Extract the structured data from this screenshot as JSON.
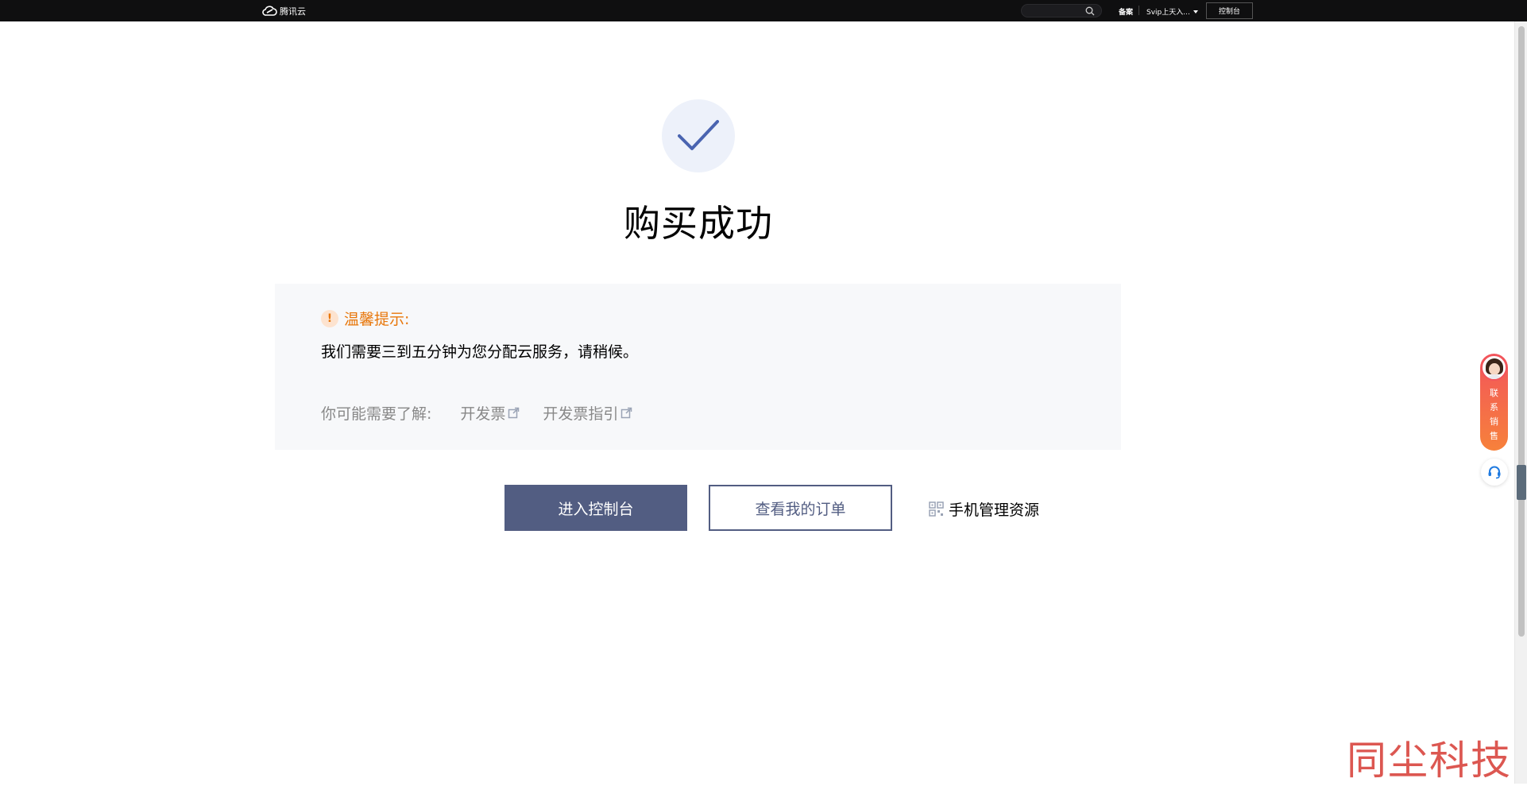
{
  "topbar": {
    "brand": "腾讯云",
    "search_placeholder": "",
    "beian": "备案",
    "user_menu": "Svip上天入...",
    "console": "控制台"
  },
  "main": {
    "title": "购买成功",
    "notice": {
      "heading": "温馨提示:",
      "body": "我们需要三到五分钟为您分配云服务，请稍候。",
      "links_label": "你可能需要了解:",
      "links": [
        "开发票",
        "开发票指引"
      ]
    },
    "actions": {
      "primary": "进入控制台",
      "secondary": "查看我的订单",
      "mobile": "手机管理资源"
    }
  },
  "floating": {
    "sales_label": "联系销售"
  },
  "watermark": "同尘科技",
  "colors": {
    "primary": "#525d82",
    "notice_accent": "#e8770b",
    "check": "#4a64b0"
  }
}
